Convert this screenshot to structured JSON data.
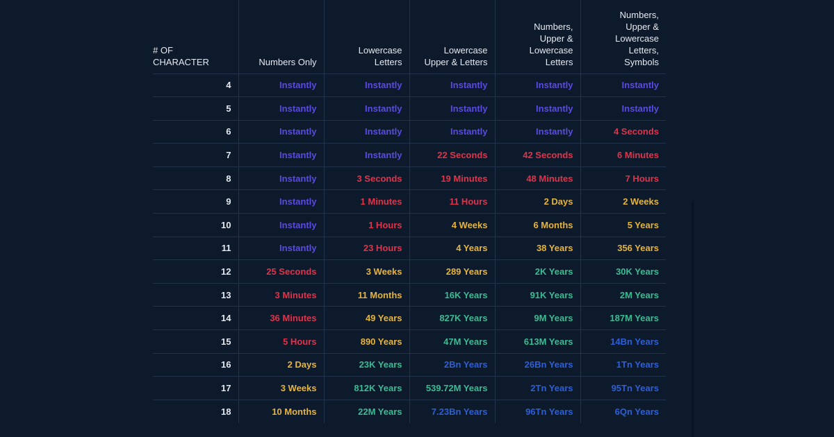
{
  "colors": {
    "instant": "#5a4be0",
    "red": "#e0334a",
    "yellow": "#e6b43c",
    "teal": "#3bbb92",
    "blue": "#2d5fd6",
    "background": "#0d1a2c"
  },
  "headers": [
    "# OF\nCHARACTER",
    "Numbers Only",
    "Lowercase\nLetters",
    "Lowercase\nUpper & Letters",
    "Numbers,\nUpper &\nLowercase\nLetters",
    "Numbers,\nUpper &\nLowercase\nLetters,\nSymbols"
  ],
  "rows": [
    {
      "n": "4",
      "cells": [
        [
          "Instantly",
          "instant"
        ],
        [
          "Instantly",
          "instant"
        ],
        [
          "Instantly",
          "instant"
        ],
        [
          "Instantly",
          "instant"
        ],
        [
          "Instantly",
          "instant"
        ]
      ]
    },
    {
      "n": "5",
      "cells": [
        [
          "Instantly",
          "instant"
        ],
        [
          "Instantly",
          "instant"
        ],
        [
          "Instantly",
          "instant"
        ],
        [
          "Instantly",
          "instant"
        ],
        [
          "Instantly",
          "instant"
        ]
      ]
    },
    {
      "n": "6",
      "cells": [
        [
          "Instantly",
          "instant"
        ],
        [
          "Instantly",
          "instant"
        ],
        [
          "Instantly",
          "instant"
        ],
        [
          "Instantly",
          "instant"
        ],
        [
          "4 Seconds",
          "red"
        ]
      ]
    },
    {
      "n": "7",
      "cells": [
        [
          "Instantly",
          "instant"
        ],
        [
          "Instantly",
          "instant"
        ],
        [
          "22 Seconds",
          "red"
        ],
        [
          "42 Seconds",
          "red"
        ],
        [
          "6 Minutes",
          "red"
        ]
      ]
    },
    {
      "n": "8",
      "cells": [
        [
          "Instantly",
          "instant"
        ],
        [
          "3 Seconds",
          "red"
        ],
        [
          "19 Minutes",
          "red"
        ],
        [
          "48 Minutes",
          "red"
        ],
        [
          "7 Hours",
          "red"
        ]
      ]
    },
    {
      "n": "9",
      "cells": [
        [
          "Instantly",
          "instant"
        ],
        [
          "1 Minutes",
          "red"
        ],
        [
          "11 Hours",
          "red"
        ],
        [
          "2 Days",
          "yellow"
        ],
        [
          "2 Weeks",
          "yellow"
        ]
      ]
    },
    {
      "n": "10",
      "cells": [
        [
          "Instantly",
          "instant"
        ],
        [
          "1 Hours",
          "red"
        ],
        [
          "4 Weeks",
          "yellow"
        ],
        [
          "6 Months",
          "yellow"
        ],
        [
          "5 Years",
          "yellow"
        ]
      ]
    },
    {
      "n": "11",
      "cells": [
        [
          "Instantly",
          "instant"
        ],
        [
          "23 Hours",
          "red"
        ],
        [
          "4 Years",
          "yellow"
        ],
        [
          "38 Years",
          "yellow"
        ],
        [
          "356 Years",
          "yellow"
        ]
      ]
    },
    {
      "n": "12",
      "cells": [
        [
          "25 Seconds",
          "red"
        ],
        [
          "3 Weeks",
          "yellow"
        ],
        [
          "289 Years",
          "yellow"
        ],
        [
          "2K Years",
          "teal"
        ],
        [
          "30K Years",
          "teal"
        ]
      ]
    },
    {
      "n": "13",
      "cells": [
        [
          "3 Minutes",
          "red"
        ],
        [
          "11 Months",
          "yellow"
        ],
        [
          "16K Years",
          "teal"
        ],
        [
          "91K Years",
          "teal"
        ],
        [
          "2M Years",
          "teal"
        ]
      ]
    },
    {
      "n": "14",
      "cells": [
        [
          "36 Minutes",
          "red"
        ],
        [
          "49 Years",
          "yellow"
        ],
        [
          "827K Years",
          "teal"
        ],
        [
          "9M Years",
          "teal"
        ],
        [
          "187M Years",
          "teal"
        ]
      ]
    },
    {
      "n": "15",
      "cells": [
        [
          "5 Hours",
          "red"
        ],
        [
          "890 Years",
          "yellow"
        ],
        [
          "47M Years",
          "teal"
        ],
        [
          "613M Years",
          "teal"
        ],
        [
          "14Bn Years",
          "blue"
        ]
      ]
    },
    {
      "n": "16",
      "cells": [
        [
          "2 Days",
          "yellow"
        ],
        [
          "23K Years",
          "teal"
        ],
        [
          "2Bn Years",
          "blue"
        ],
        [
          "26Bn Years",
          "blue"
        ],
        [
          "1Tn Years",
          "blue"
        ]
      ]
    },
    {
      "n": "17",
      "cells": [
        [
          "3 Weeks",
          "yellow"
        ],
        [
          "812K Years",
          "teal"
        ],
        [
          "539.72M Years",
          "teal"
        ],
        [
          "2Tn Years",
          "blue"
        ],
        [
          "95Tn Years",
          "blue"
        ]
      ]
    },
    {
      "n": "18",
      "cells": [
        [
          "10 Months",
          "yellow"
        ],
        [
          "22M Years",
          "teal"
        ],
        [
          "7.23Bn Years",
          "blue"
        ],
        [
          "96Tn Years",
          "blue"
        ],
        [
          "6Qn Years",
          "blue"
        ]
      ]
    }
  ]
}
